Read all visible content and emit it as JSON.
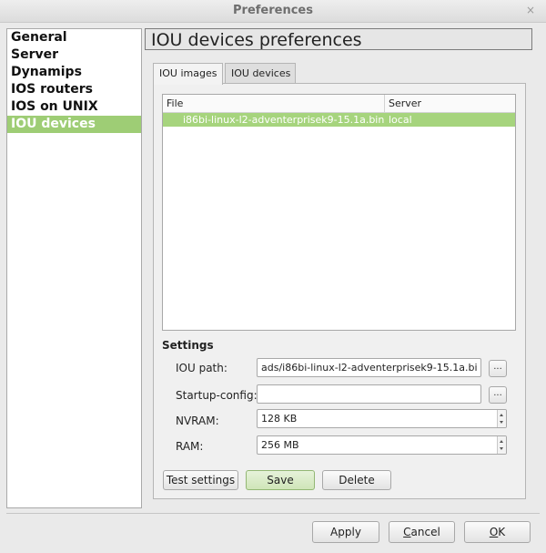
{
  "window": {
    "title": "Preferences",
    "close_glyph": "×"
  },
  "sidebar": {
    "items": [
      {
        "label": "General"
      },
      {
        "label": "Server"
      },
      {
        "label": "Dynamips"
      },
      {
        "label": "IOS routers"
      },
      {
        "label": "IOS on UNIX"
      },
      {
        "label": "IOU devices",
        "selected": true
      }
    ]
  },
  "main": {
    "title": "IOU devices preferences",
    "tabs": [
      {
        "label": "IOU images",
        "active": true
      },
      {
        "label": "IOU devices",
        "active": false
      }
    ],
    "table": {
      "columns": [
        "File",
        "Server"
      ],
      "rows": [
        {
          "file": "i86bi-linux-l2-adventerprisek9-15.1a.bin",
          "server": "local",
          "selected": true
        }
      ]
    },
    "settings": {
      "heading": "Settings",
      "iou_path": {
        "label": "IOU path:",
        "value": "ads/i86bi-linux-l2-adventerprisek9-15.1a.bin",
        "browse": "..."
      },
      "startup_config": {
        "label": "Startup-config:",
        "value": "",
        "browse": "..."
      },
      "nvram": {
        "label": "NVRAM:",
        "value": "128 KB"
      },
      "ram": {
        "label": "RAM:",
        "value": "256 MB"
      }
    },
    "buttons": {
      "test": "Test settings",
      "save": "Save",
      "delete": "Delete"
    }
  },
  "footer": {
    "apply": "Apply",
    "cancel_first": "C",
    "cancel_rest": "ancel",
    "ok_first": "O",
    "ok_rest": "K"
  },
  "colors": {
    "selection": "#9ecd75",
    "row_selected": "#a6d47d"
  }
}
